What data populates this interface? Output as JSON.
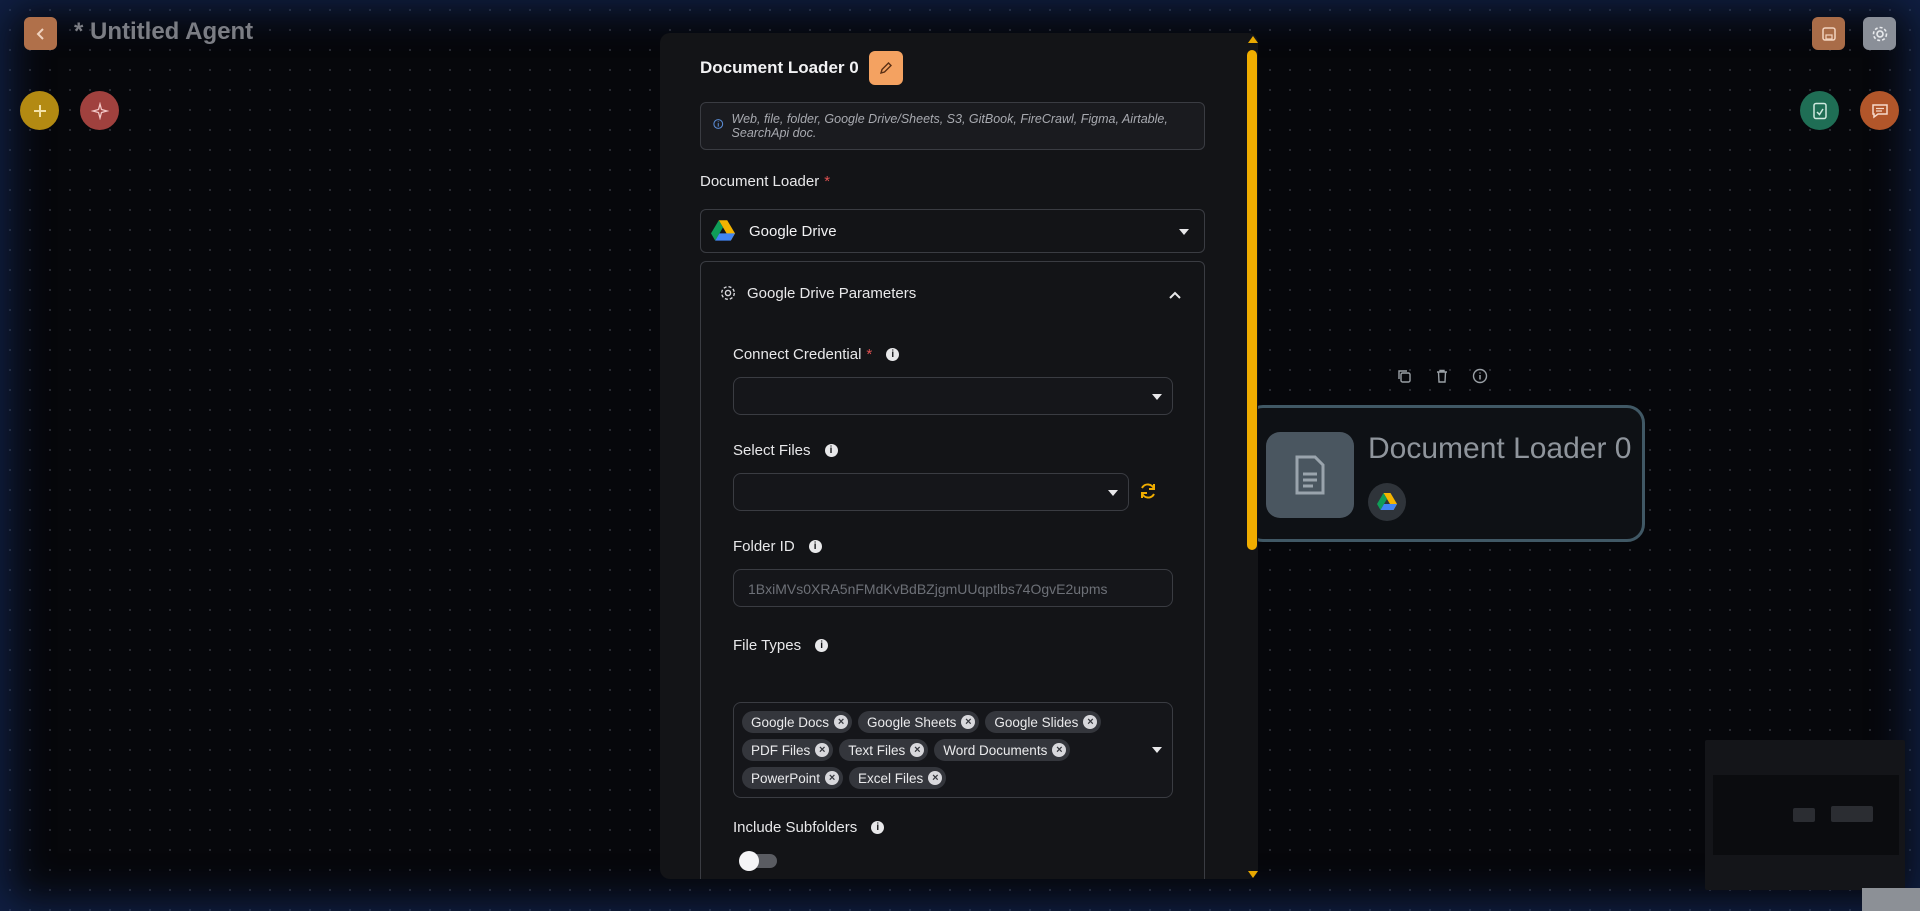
{
  "header": {
    "title": "* Untitled Agent"
  },
  "node": {
    "title": "Document Loader 0"
  },
  "panel": {
    "title": "Document Loader 0",
    "info_text": "Web, file, folder, Google Drive/Sheets, S3, GitBook, FireCrawl, Figma, Airtable, SearchApi doc.",
    "loader_label": "Document Loader",
    "loader_required": "*",
    "loader_value": "Google Drive",
    "params_title": "Google Drive Parameters",
    "credential_label": "Connect Credential",
    "credential_required": "*",
    "select_files_label": "Select Files",
    "folder_id_label": "Folder ID",
    "folder_id_placeholder": "1BxiMVs0XRA5nFMdKvBdBZjgmUUqptlbs74OgvE2upms",
    "file_types_label": "File Types",
    "file_types": [
      "Google Docs",
      "Google Sheets",
      "Google Slides",
      "PDF Files",
      "Text Files",
      "Word Documents",
      "PowerPoint",
      "Excel Files"
    ],
    "include_subfolders_label": "Include Subfolders",
    "include_subfolders": false
  },
  "colors": {
    "accent_orange": "#f4a261",
    "scrollbar": "#f0ad00",
    "required": "#e05252"
  }
}
